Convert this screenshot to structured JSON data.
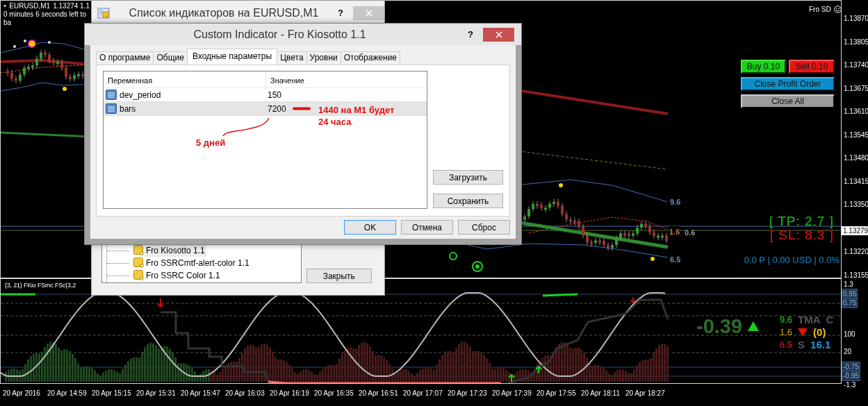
{
  "chart": {
    "symbol": "EURUSD,M1",
    "prices": "1.13274 1.1",
    "countdown": "0 minutes 6 seconds left to ba",
    "expert_label": "Fro SD",
    "trade_buttons": [
      {
        "label": "Buy 0.10",
        "kind": "buy"
      },
      {
        "label": "Sell 0.10",
        "kind": "sell"
      },
      {
        "label": "Close Profit Order",
        "kind": "close_profit"
      },
      {
        "label": "Close All",
        "kind": "close_all"
      }
    ],
    "take_profit": "[ TP: 2.7 ]",
    "stop_loss": "[ SL: 8.3 ]",
    "account_line": "0.0 P | 0.00 USD | 0.0%",
    "band_labels": [
      {
        "text": "9.6",
        "color": "#6d8fb8"
      },
      {
        "text": "1.6",
        "color": "#c8783c"
      },
      {
        "text": "0.6",
        "color": "#9a9a9a"
      },
      {
        "text": "6.5",
        "color": "#6d8fb8"
      }
    ],
    "price_axis": [
      "1.13870",
      "1.13805",
      "1.13740",
      "1.13675",
      "1.13610",
      "1.13545",
      "1.13480",
      "1.13415",
      "1.13350",
      "1.13220",
      "1.13155"
    ],
    "bid_price": "1.13279"
  },
  "oscillator": {
    "header": "(3, 21)  FKio  FSmc  FSc(3,2",
    "reading": "-0.39",
    "reading_arrow": {
      "kind": "arrow_up",
      "color": "#19d119"
    },
    "rows": [
      {
        "cells": [
          {
            "kind": "text",
            "text": "9.6",
            "color": "#2ad12a"
          },
          {
            "kind": "text",
            "text": "TMA",
            "color": "#555555"
          },
          {
            "kind": "text",
            "text": "C",
            "color": "#555555"
          }
        ]
      },
      {
        "cells": [
          {
            "kind": "text",
            "text": "1.6",
            "color": "#d4a017"
          },
          {
            "kind": "arrow_down",
            "color": "#e01010"
          },
          {
            "kind": "text",
            "text": "(0)",
            "color": "#e8c21a"
          }
        ]
      },
      {
        "cells": [
          {
            "kind": "text",
            "text": "6.5",
            "color": "#e02020"
          },
          {
            "kind": "text",
            "text": "S",
            "color": "#555555"
          },
          {
            "kind": "text",
            "text": "16.1",
            "color": "#1e9be0"
          }
        ]
      }
    ],
    "axis": [
      {
        "text": "1.3",
        "boxed": false
      },
      {
        "text": "0.95",
        "boxed": true
      },
      {
        "text": "0.75",
        "boxed": true
      },
      {
        "text": "100",
        "boxed": false
      },
      {
        "text": "20",
        "boxed": false
      },
      {
        "text": "-0.75",
        "boxed": true
      },
      {
        "text": "-0.95",
        "boxed": true
      },
      {
        "text": "-1.3",
        "boxed": false
      }
    ]
  },
  "time_axis": [
    "20 Apr 2016",
    "20 Apr 14:59",
    "20 Apr 15:15",
    "20 Apr 15:31",
    "20 Apr 15:47",
    "20 Apr 16:03",
    "20 Apr 16:19",
    "20 Apr 16:35",
    "20 Apr 16:51",
    "20 Apr 17:07",
    "20 Apr 17:23",
    "20 Apr 17:39",
    "20 Apr 17:55",
    "20 Apr 18:11",
    "20 Apr 18:27"
  ],
  "indicator_list_window": {
    "title": "Список индикаторов на EURUSD,M1",
    "help": "?",
    "items": [
      {
        "label": "Fro Kiosotto 1.1",
        "selected": true
      },
      {
        "label": "Fro SSRCmtf-alert-color 1.1",
        "selected": false
      },
      {
        "label": "Fro SSRC Color 1.1",
        "selected": false
      }
    ],
    "close_button": "Закрыть"
  },
  "indicator_window": {
    "title": "Custom Indicator - Fro Kiosotto 1.1",
    "help": "?",
    "tabs": [
      {
        "label": "О программе",
        "selected": false
      },
      {
        "label": "Общие",
        "selected": false
      },
      {
        "label": "Входные параметры",
        "selected": true
      },
      {
        "label": "Цвета",
        "selected": false
      },
      {
        "label": "Уровни",
        "selected": false
      },
      {
        "label": "Отображение",
        "selected": false
      }
    ],
    "columns": [
      "Переменная",
      "Значение"
    ],
    "rows": [
      {
        "name": "dev_period",
        "value": "150",
        "selected": false
      },
      {
        "name": "bars",
        "value": "7200",
        "selected": true
      }
    ],
    "annotations": [
      "1440 на М1 будет",
      "24 часа",
      "5 дней"
    ],
    "side_buttons": [
      "Загрузить",
      "Сохранить"
    ],
    "buttons": [
      "OK",
      "Отмена",
      "Сброс"
    ]
  }
}
